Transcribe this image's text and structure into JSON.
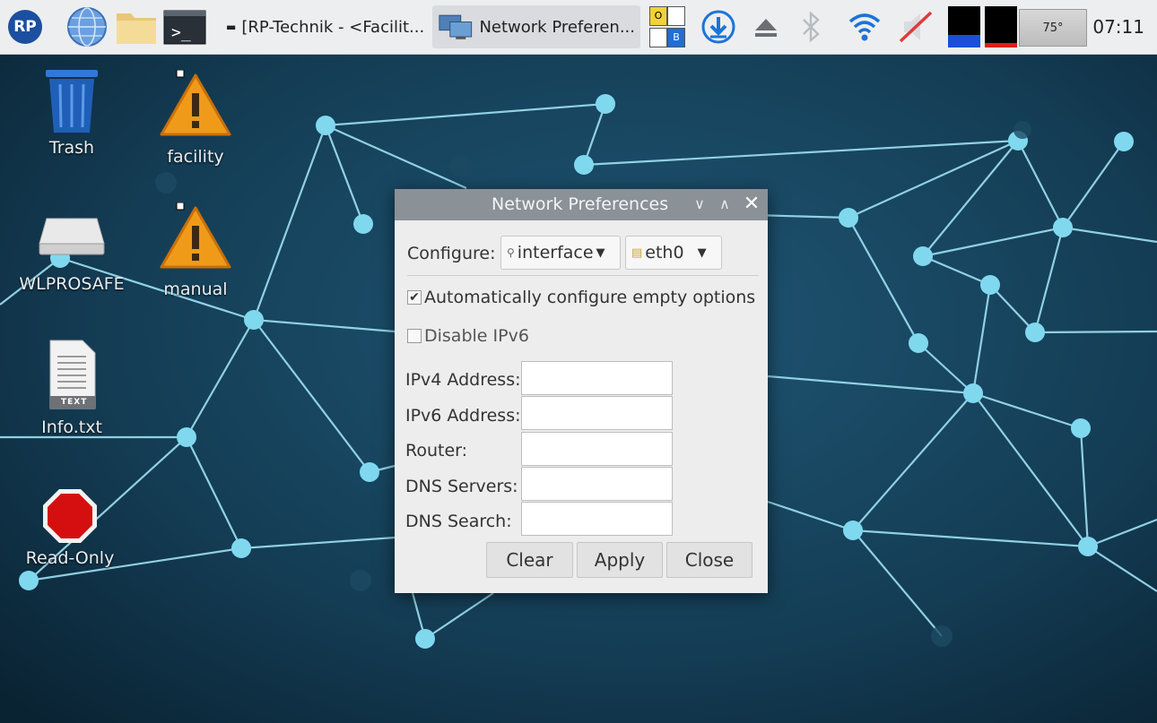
{
  "taskbar": {
    "logo_text": "RP",
    "windows": [
      {
        "label": "[RP-Technik - <Facilit...",
        "active": false
      },
      {
        "label": "Network Preferen...",
        "active": true
      }
    ],
    "keyboard_indicator": {
      "top": "O",
      "bottom": "B"
    },
    "cpu_temp": "75°",
    "clock": "07:11",
    "icons": [
      "web-browser-icon",
      "file-manager-icon",
      "terminal-icon",
      "download-icon",
      "eject-icon",
      "bluetooth-icon",
      "wifi-icon",
      "volume-muted-icon",
      "cpu-monitor-icon"
    ]
  },
  "desktop": {
    "icons": [
      {
        "label": "Trash",
        "icon": "trash-icon"
      },
      {
        "label": "facility",
        "icon": "warning-icon"
      },
      {
        "label": "WLPROSAFE",
        "icon": "drive-icon"
      },
      {
        "label": "manual",
        "icon": "warning-icon"
      },
      {
        "label": "Info.txt",
        "icon": "text-file-icon",
        "badge": "TEXT"
      },
      {
        "label": "Read-Only",
        "icon": "stop-icon"
      }
    ]
  },
  "dialog": {
    "title": "Network Preferences",
    "configure_label": "Configure:",
    "configure_type": "interface",
    "configure_device": "eth0",
    "auto_configure_label": "Automatically configure empty options",
    "auto_configure_checked": true,
    "disable_ipv6_label": "Disable IPv6",
    "disable_ipv6_checked": false,
    "fields": [
      {
        "label": "IPv4 Address:",
        "value": ""
      },
      {
        "label": "IPv6 Address:",
        "value": ""
      },
      {
        "label": "Router:",
        "value": ""
      },
      {
        "label": "DNS Servers:",
        "value": ""
      },
      {
        "label": "DNS Search:",
        "value": ""
      }
    ],
    "buttons": {
      "clear": "Clear",
      "apply": "Apply",
      "close": "Close"
    }
  },
  "colors": {
    "wallpaper": "#0f2f43",
    "node": "#7fd9f0",
    "titlebar": "#8a9197"
  }
}
